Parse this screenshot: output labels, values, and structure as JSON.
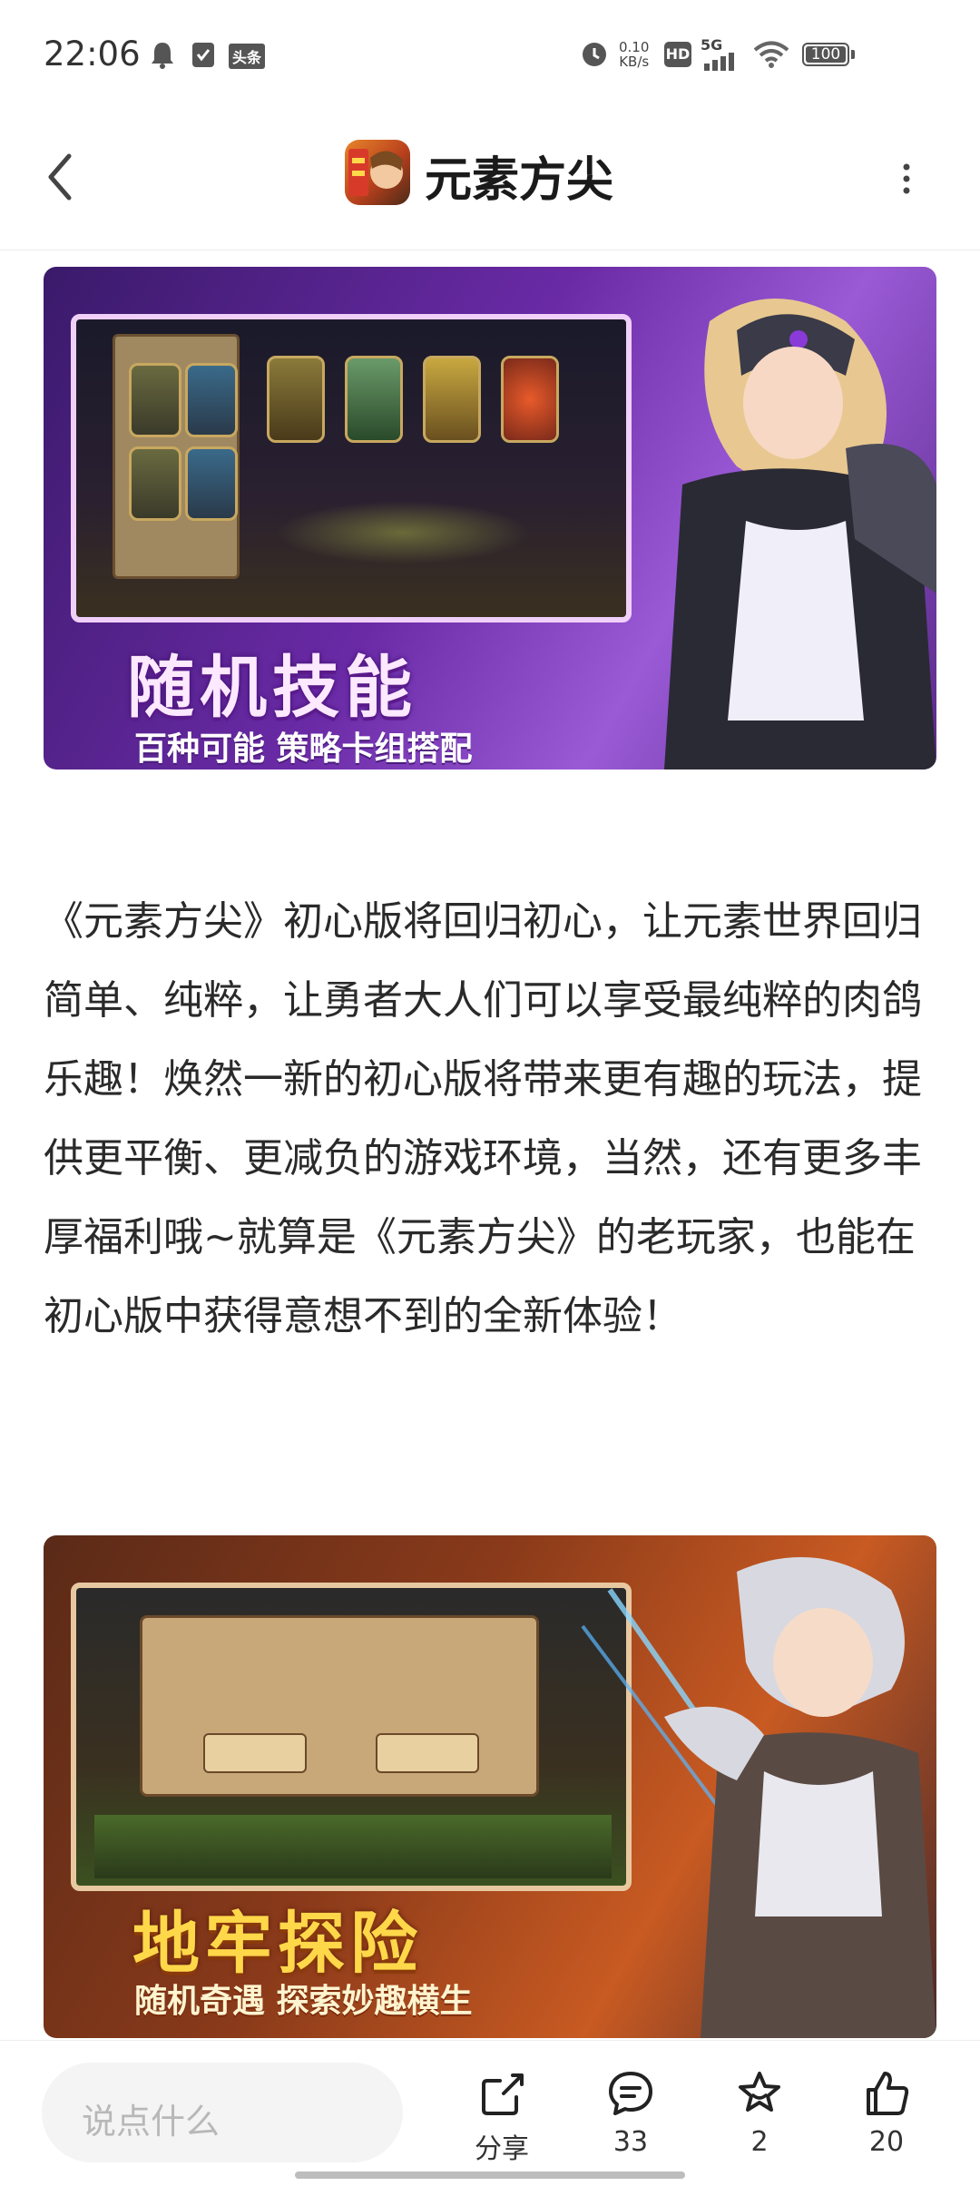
{
  "status_bar": {
    "time": "22:06",
    "toutiao": "头条",
    "net_speed_value": "0.10",
    "net_speed_unit": "KB/s",
    "hd": "HD",
    "network": "5G",
    "battery": "100"
  },
  "header": {
    "title": "元素方尖",
    "app_icon": "元素方尖"
  },
  "banners": [
    {
      "headline": "随机技能",
      "subline": "百种可能  策略卡组搭配"
    },
    {
      "headline": "地牢探险",
      "subline": "随机奇遇  探索妙趣横生"
    }
  ],
  "article": {
    "paragraph": "《元素方尖》初心版将回归初心，让元素世界回归简单、纯粹，让勇者大人们可以享受最纯粹的肉鸽乐趣！焕然一新的初心版将带来更有趣的玩法，提供更平衡、更减负的游戏环境，当然，还有更多丰厚福利哦~就算是《元素方尖》的老玩家，也能在初心版中获得意想不到的全新体验！"
  },
  "bottom_bar": {
    "comment_placeholder": "说点什么",
    "share_label": "分享",
    "comments_count": "33",
    "favorites_count": "2",
    "likes_count": "20"
  },
  "colors": {
    "accent_text": "#2a2a2a",
    "banner1_bg": "#6a2aa6",
    "banner2_bg": "#c85a22"
  },
  "icons": [
    "bell-icon",
    "check-square-icon",
    "alarm-icon",
    "wifi-icon",
    "back-arrow-icon",
    "more-vertical-icon",
    "share-icon",
    "comment-icon",
    "star-icon",
    "thumbs-up-icon"
  ]
}
